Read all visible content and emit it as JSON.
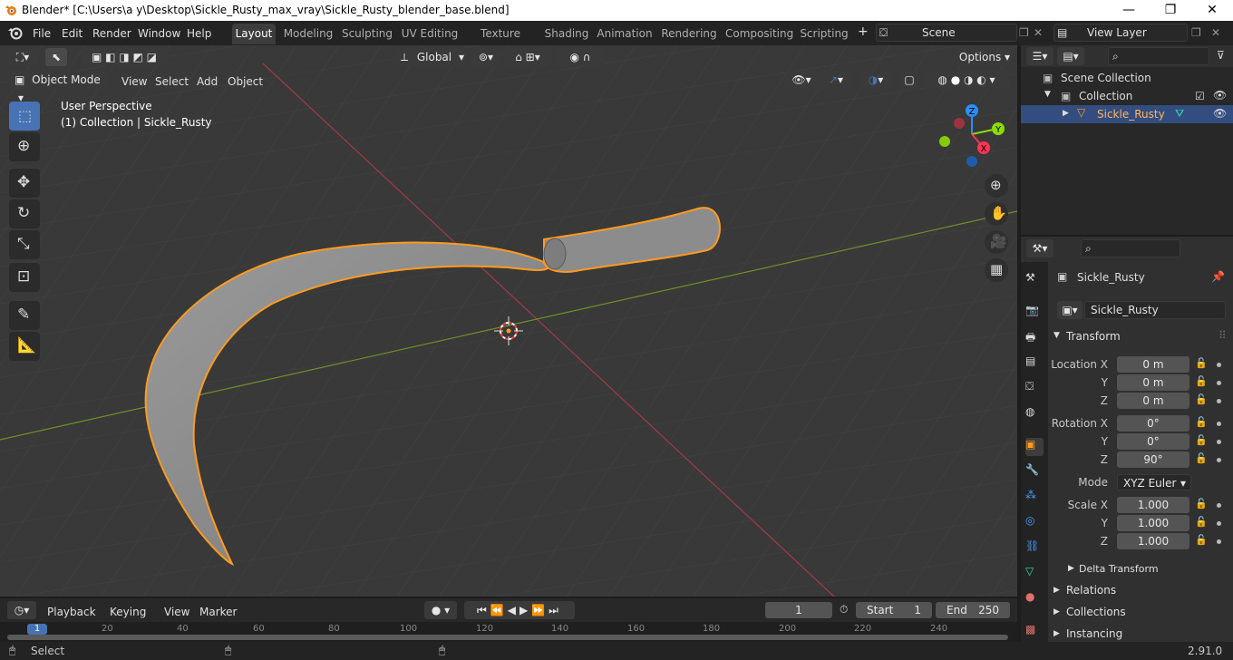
{
  "window": {
    "title": "Blender* [C:\\Users\\a y\\Desktop\\Sickle_Rusty_max_vray\\Sickle_Rusty_blender_base.blend]",
    "controls": [
      "—",
      "❐",
      "✕"
    ]
  },
  "menus": [
    "File",
    "Edit",
    "Render",
    "Window",
    "Help"
  ],
  "workspaces": {
    "tabs": [
      "Layout",
      "Modeling",
      "Sculpting",
      "UV Editing",
      "Texture Paint",
      "Shading",
      "Animation",
      "Rendering",
      "Compositing",
      "Scripting"
    ],
    "active": "Layout",
    "add": "+"
  },
  "scene": {
    "name": "Scene"
  },
  "view_layer": {
    "name": "View Layer"
  },
  "viewport_header": {
    "transform_orientation": "Global",
    "options": "Options",
    "mode": "Object Mode",
    "menus": [
      "View",
      "Select",
      "Add",
      "Object"
    ]
  },
  "viewport": {
    "perspective": "User Perspective",
    "context": "(1) Collection | Sickle_Rusty",
    "gizmo": {
      "x": "X",
      "y": "Y",
      "z": "Z"
    }
  },
  "outliner": {
    "root": "Scene Collection",
    "collection": "Collection",
    "object": "Sickle_Rusty"
  },
  "properties": {
    "object_name": "Sickle_Rusty",
    "data_name": "Sickle_Rusty",
    "transform_label": "Transform",
    "location": {
      "label": "Location X",
      "y_label": "Y",
      "z_label": "Z",
      "x": "0 m",
      "y": "0 m",
      "z": "0 m"
    },
    "rotation": {
      "label": "Rotation X",
      "y_label": "Y",
      "z_label": "Z",
      "x": "0°",
      "y": "0°",
      "z": "90°"
    },
    "mode": {
      "label": "Mode",
      "value": "XYZ Euler"
    },
    "scale": {
      "label": "Scale X",
      "y_label": "Y",
      "z_label": "Z",
      "x": "1.000",
      "y": "1.000",
      "z": "1.000"
    },
    "delta_transform": "Delta Transform",
    "relations": "Relations",
    "collections": "Collections",
    "instancing": "Instancing"
  },
  "timeline": {
    "menus": [
      "Playback",
      "Keying",
      "View",
      "Marker"
    ],
    "current_frame": "1",
    "start_label": "Start",
    "start": "1",
    "end_label": "End",
    "end": "250",
    "ruler_marks": [
      "1",
      "20",
      "40",
      "60",
      "80",
      "100",
      "120",
      "140",
      "160",
      "180",
      "200",
      "220",
      "240"
    ]
  },
  "status": {
    "left": "Select",
    "version": "2.91.0"
  },
  "colors": {
    "accent": "#4772b3",
    "selection": "#ff9a1f",
    "x_axis": "#ff3352",
    "y_axis": "#8bdc00",
    "z_axis": "#2890ff"
  }
}
